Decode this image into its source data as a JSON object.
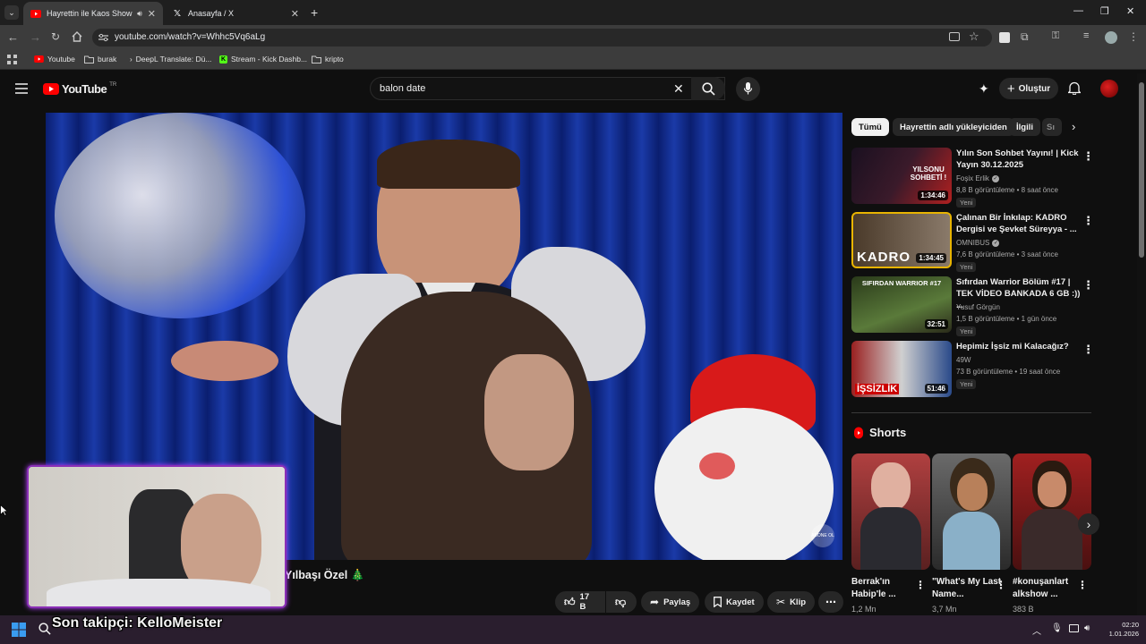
{
  "browser": {
    "tabs": [
      {
        "title": "Hayrettin ile Kaos Show - 2",
        "active": true,
        "icon": "youtube-icon"
      },
      {
        "title": "Anasayfa / X",
        "active": false,
        "icon": "x-icon"
      }
    ],
    "url": "youtube.com/watch?v=Whhc5Vq6aLg",
    "bookmarks": [
      {
        "label": "Youtube",
        "icon": "youtube-icon"
      },
      {
        "label": "burak",
        "icon": "folder-icon"
      },
      {
        "label": "DeepL Translate: Dü...",
        "icon": "deepl-icon"
      },
      {
        "label": "Stream - Kick Dashb...",
        "icon": "kick-icon"
      },
      {
        "label": "kripto",
        "icon": "folder-icon"
      }
    ]
  },
  "youtube": {
    "logo_text": "YouTube",
    "country": "TR",
    "search_value": "balon date",
    "create_label": "Oluştur"
  },
  "video": {
    "title_fragment": "Yılbaşı Özel 🎄",
    "watermark": "ABONE OL",
    "actions": {
      "likes": "17 B",
      "share": "Paylaş",
      "save": "Kaydet",
      "clip": "Klip"
    }
  },
  "chips": [
    "Tümü",
    "Hayrettin adlı yükleyiciden",
    "İlgili",
    "Sı"
  ],
  "recommendations": [
    {
      "title": "Yılın Son Sohbet Yayını! | Kick Yayın 30.12.2025",
      "channel": "Foşix Erlik",
      "verified": true,
      "meta": "8,8 B görüntüleme • 8 saat önce",
      "badge": "Yeni",
      "duration": "1:34:46",
      "thumb_text": "YILSONU SOHBETİ !",
      "accent": "#c0392b"
    },
    {
      "title": "Çalınan Bir İnkılap: KADRO Dergisi ve Şevket Süreyya - ...",
      "channel": "OMNIBUS",
      "verified": true,
      "meta": "7,6 B görüntüleme • 3 saat önce",
      "badge": "Yeni",
      "duration": "1:34:45",
      "thumb_text": "KADRO",
      "accent": "#e8b400"
    },
    {
      "title": "Sıfırdan Warrior Bölüm #17 | TEK VİDEO BANKADA 6 GB :)) ...",
      "channel": "Yusuf Görgün",
      "verified": false,
      "meta": "1,5 B görüntüleme • 1 gün önce",
      "badge": "Yeni",
      "duration": "32:51",
      "thumb_text": "SIFIRDAN WARRIOR #17",
      "accent": "#4a6a2a"
    },
    {
      "title": "Hepimiz İşsiz mi Kalacağız?",
      "channel": "49W",
      "verified": false,
      "meta": "73 B görüntüleme • 19 saat önce",
      "badge": "Yeni",
      "duration": "51:46",
      "thumb_text": "İŞSİZLİK",
      "accent": "#c0392b"
    }
  ],
  "shorts": {
    "header": "Shorts",
    "items": [
      {
        "title": "Berrak'ın Habip'le ...",
        "views": "1,2 Mn",
        "bg": "#a33a3a"
      },
      {
        "title": "\"What's My Last Name...",
        "views": "3,7 Mn",
        "bg": "#4a4a4a"
      },
      {
        "title": "#konuşanlart alkshow ...",
        "views": "383 B",
        "bg": "#8a2a2a"
      }
    ]
  },
  "stream_overlay": {
    "follower_text": "Son takipçi: KelloMeister"
  },
  "taskbar": {
    "time": "02:20",
    "date": "1.01.2026"
  }
}
